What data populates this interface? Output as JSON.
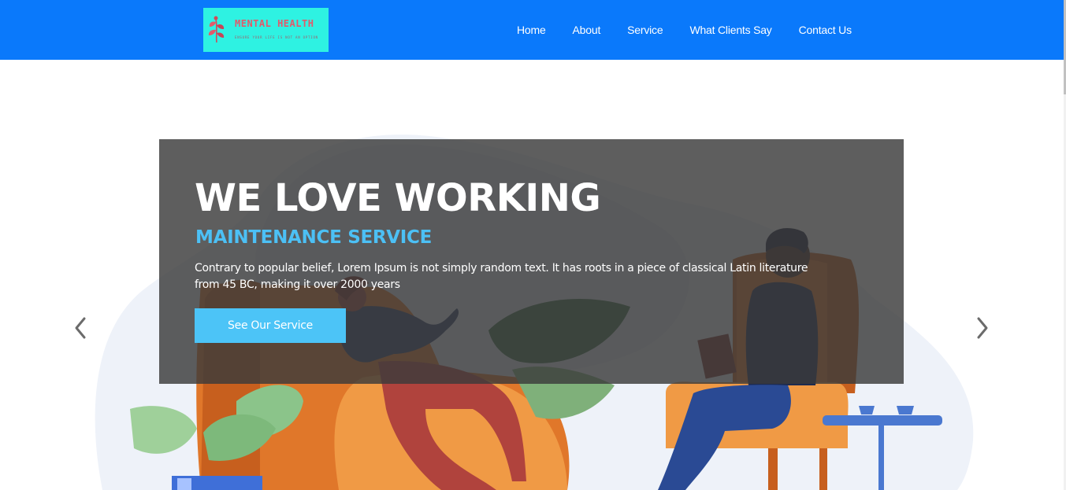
{
  "header": {
    "logo": {
      "title": "MENTAL HEALTH",
      "tagline": "ENSURE YOUR LIFE IS NOT AN OPTION"
    },
    "nav": [
      {
        "label": "Home"
      },
      {
        "label": "About"
      },
      {
        "label": "Service"
      },
      {
        "label": "What Clients Say"
      },
      {
        "label": "Contact Us"
      }
    ]
  },
  "hero": {
    "title": "WE LOVE WORKING",
    "subtitle": "MAINTENANCE SERVICE",
    "text": "Contrary to popular belief, Lorem Ipsum is not simply random text. It has roots in a piece of classical Latin literature from 45 BC, making it over 2000 years",
    "button_label": "See Our Service"
  },
  "carousel": {
    "prev_icon": "chevron-left-icon",
    "next_icon": "chevron-right-icon"
  },
  "colors": {
    "navbar": "#0a79fb",
    "logo_bg": "#2ef2e2",
    "accent": "#4cc4f7",
    "overlay": "#3a3a3a"
  }
}
